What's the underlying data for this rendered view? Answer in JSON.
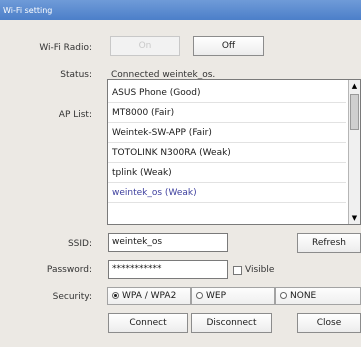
{
  "window": {
    "title": "Wi-Fi setting"
  },
  "radio": {
    "label": "Wi-Fi Radio:",
    "on_label": "On",
    "off_label": "Off"
  },
  "status": {
    "label": "Status:",
    "value": "Connected weintek_os."
  },
  "ap_list": {
    "label": "AP List:",
    "items": [
      "ASUS Phone (Good)",
      "MT8000 (Fair)",
      "Weintek-SW-APP (Fair)",
      "TOTOLINK N300RA (Weak)",
      "tplink (Weak)",
      "weintek_os (Weak)"
    ],
    "selected_index": 5
  },
  "ssid": {
    "label": "SSID:",
    "value": "weintek_os",
    "refresh_label": "Refresh"
  },
  "password": {
    "label": "Password:",
    "value": "***********",
    "visible_label": "Visible"
  },
  "security": {
    "label": "Security:",
    "options": [
      "WPA / WPA2",
      "WEP",
      "NONE"
    ],
    "selected": "WPA / WPA2"
  },
  "actions": {
    "connect_label": "Connect",
    "disconnect_label": "Disconnect",
    "close_label": "Close"
  },
  "colors": {
    "title_bar": "#5b8ad2",
    "selected_item_text": "#3d3f9e"
  }
}
